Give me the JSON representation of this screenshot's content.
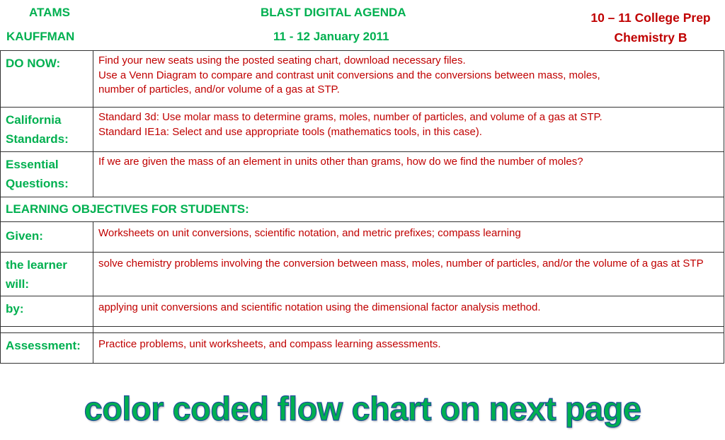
{
  "header": {
    "teacher_line1": "ATAMS",
    "teacher_line2": "KAUFFMAN",
    "title": "BLAST DIGITAL AGENDA",
    "date": "11 - 12 January 2011",
    "course": "10 – 11 College Prep Chemistry B"
  },
  "agenda": {
    "do_now": {
      "label": "DO NOW:",
      "lines": [
        "Find your new seats using the posted seating chart, download necessary files.",
        "Use a Venn Diagram to compare and contrast unit conversions and the conversions between mass, moles,",
        "number of particles, and/or volume of a gas at STP."
      ]
    },
    "standards": {
      "label": "California Standards:",
      "lines": [
        "Standard 3d: Use molar mass to determine grams, moles, number of particles, and volume of a gas at STP.",
        "Standard IE1a: Select and use appropriate tools (mathematics tools, in this case)."
      ]
    },
    "essential_questions": {
      "label": "Essential Questions:",
      "text": "If we are given the mass of an element in units other than grams, how do we find the number of moles?"
    },
    "learning_objectives_heading": "LEARNING OBJECTIVES FOR STUDENTS:",
    "given": {
      "label": "Given:",
      "text": "Worksheets on unit conversions, scientific notation, and metric prefixes; compass learning"
    },
    "learner_will": {
      "label": "the learner will:",
      "text": "solve chemistry problems involving the conversion between mass, moles, number of particles, and/or the volume of a gas at STP"
    },
    "by": {
      "label": "by:",
      "text": "applying unit conversions and scientific notation using the dimensional factor analysis method."
    },
    "assessment": {
      "label": "Assessment:",
      "text": "Practice problems, unit worksheets, and compass learning assessments."
    }
  },
  "footer": {
    "note": "color coded flow chart on next page"
  },
  "colors": {
    "label_green": "#00b050",
    "body_red": "#c00000",
    "outline_blue": "#1f4e9a"
  }
}
